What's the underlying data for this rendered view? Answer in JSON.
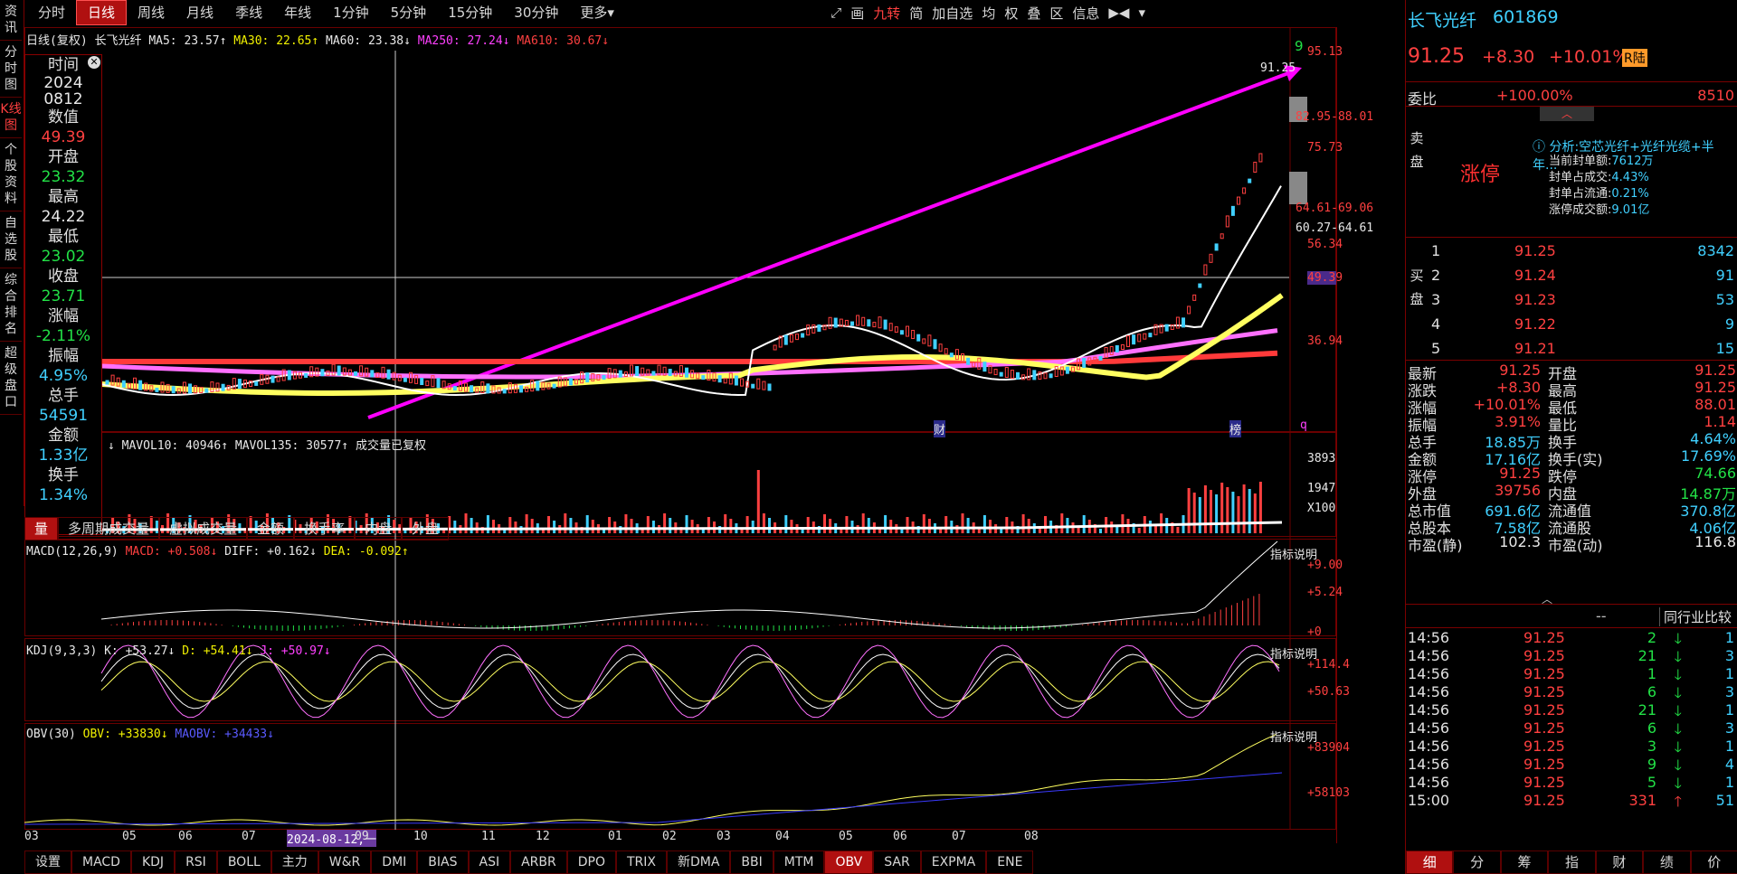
{
  "top_tabs": [
    "分时",
    "日线",
    "周线",
    "月线",
    "季线",
    "年线",
    "1分钟",
    "5分钟",
    "15分钟",
    "30分钟",
    "更多▾"
  ],
  "active_tab": "日线",
  "tool_icons": [
    "⤢",
    "画",
    "九转",
    "简",
    "加自选",
    "均",
    "权",
    "叠",
    "区",
    "信息",
    "▶◀",
    "▾"
  ],
  "left_nav": [
    "资讯",
    "分时图",
    "K线图",
    "个股资料",
    "自选股",
    "综合排名",
    "超级盘口"
  ],
  "chart_header": {
    "title": "日线(复权)",
    "name": "长飞光纤",
    "ma5": "MA5: 23.57↑",
    "ma30": "MA30: 22.65↑",
    "ma60": "MA60: 23.38↓",
    "ma250": "MA250: 27.24↓",
    "ma610": "MA610: 30.67↓"
  },
  "price_axis": [
    "95.13",
    "82.95-88.01",
    "75.73",
    "64.61-69.06",
    "60.27-64.61",
    "56.34",
    "49.39",
    "36.94"
  ],
  "price_peak_label": "91.25",
  "info_box": {
    "time_label": "时间",
    "time_value": "2024\n0812",
    "value_label": "数值",
    "value": "49.39",
    "open_label": "开盘",
    "open": "23.32",
    "high_label": "最高",
    "high": "24.22",
    "low_label": "最低",
    "low": "23.02",
    "close_label": "收盘",
    "close": "23.71",
    "chg_label": "涨幅",
    "chg": "-2.11%",
    "amp_label": "振幅",
    "amp": "4.95%",
    "vol_label": "总手",
    "vol": "54591",
    "amt_label": "金额",
    "amt": "1.33亿",
    "turn_label": "换手",
    "turn": "1.34%"
  },
  "vol_header": {
    "a": "↓ MAVOL10: 40946↑",
    "b": "MAVOL135: 30577↑",
    "c": "成交量已复权"
  },
  "vol_axis": [
    "3893",
    "1947",
    "X100"
  ],
  "sub_tabs": [
    "量",
    "多周期成交量",
    "虚拟成交量",
    "金额",
    "换手率",
    "内盘",
    "外盘"
  ],
  "macd_header": {
    "a": "MACD(12,26,9)",
    "b": "MACD: +0.508↓",
    "c": "DIFF: +0.162↓",
    "d": "DEA: -0.092↑"
  },
  "macd_axis": [
    "+9.00",
    "+5.24",
    "+0"
  ],
  "kdj_header": {
    "a": "KDJ(9,3,3)",
    "b": "K: +53.27↓",
    "c": "D: +54.41↓",
    "d": "J: +50.97↓"
  },
  "kdj_axis": [
    "+114.4",
    "+50.63"
  ],
  "obv_header": {
    "a": "OBV(30)",
    "b": "OBV: +33830↓",
    "c": "MAOBV: +34433↓"
  },
  "obv_axis": [
    "+83904",
    "+58103"
  ],
  "indicator_help": "指标说明",
  "x_axis": [
    "03",
    "05",
    "06",
    "07",
    "2024-08-12,一",
    "09",
    "10",
    "11",
    "12",
    "01",
    "02",
    "03",
    "04",
    "05",
    "06",
    "07",
    "08"
  ],
  "bottom_tabs": [
    "设置",
    "MACD",
    "KDJ",
    "RSI",
    "BOLL",
    "主力",
    "W&R",
    "DMI",
    "BIAS",
    "ASI",
    "ARBR",
    "DPO",
    "TRIX",
    "新DMA",
    "BBI",
    "MTM",
    "OBV",
    "SAR",
    "EXPMA",
    "ENE"
  ],
  "active_bottom": "OBV",
  "stock": {
    "name": "长飞光纤",
    "code": "601869",
    "price": "91.25",
    "change": "+8.30",
    "pct": "+10.01%",
    "badge": "R陆"
  },
  "weibi": {
    "label": "委比",
    "value": "+100.00%",
    "count": "8510"
  },
  "limit_up": {
    "sell_label": "卖盘",
    "status": "涨停",
    "analysis": "分析:空芯光纤+光纤光缆+半年...",
    "lines": [
      {
        "k": "当前封单额:",
        "v": "7612万"
      },
      {
        "k": "封单占成交:",
        "v": "4.43%"
      },
      {
        "k": "封单占流通:",
        "v": "0.21%"
      },
      {
        "k": "涨停成交额:",
        "v": "9.01亿"
      }
    ]
  },
  "buy_label": "买盘",
  "bids": [
    {
      "n": "1",
      "p": "91.25",
      "v": "8342"
    },
    {
      "n": "2",
      "p": "91.24",
      "v": "91"
    },
    {
      "n": "3",
      "p": "91.23",
      "v": "53"
    },
    {
      "n": "4",
      "p": "91.22",
      "v": "9"
    },
    {
      "n": "5",
      "p": "91.21",
      "v": "15"
    }
  ],
  "quote": [
    {
      "k1": "最新",
      "v1": "91.25",
      "c1": "red",
      "k2": "开盘",
      "v2": "91.25",
      "c2": "red"
    },
    {
      "k1": "涨跌",
      "v1": "+8.30",
      "c1": "red",
      "k2": "最高",
      "v2": "91.25",
      "c2": "red"
    },
    {
      "k1": "涨幅",
      "v1": "+10.01%",
      "c1": "red",
      "k2": "最低",
      "v2": "88.01",
      "c2": "red"
    },
    {
      "k1": "振幅",
      "v1": "3.91%",
      "c1": "red",
      "k2": "量比",
      "v2": "1.14",
      "c2": "red"
    },
    {
      "k1": "总手",
      "v1": "18.85万",
      "c1": "cyan",
      "k2": "换手",
      "v2": "4.64%",
      "c2": "cyan"
    },
    {
      "k1": "金额",
      "v1": "17.16亿",
      "c1": "cyan",
      "k2": "换手(实)",
      "v2": "17.69%",
      "c2": "cyan"
    },
    {
      "k1": "涨停",
      "v1": "91.25",
      "c1": "red",
      "k2": "跌停",
      "v2": "74.66",
      "c2": "green"
    },
    {
      "k1": "外盘",
      "v1": "39756",
      "c1": "red",
      "k2": "内盘",
      "v2": "14.87万",
      "c2": "green"
    },
    {
      "k1": "总市值",
      "v1": "691.6亿",
      "c1": "cyan",
      "k2": "流通值",
      "v2": "370.8亿",
      "c2": "cyan"
    },
    {
      "k1": "总股本",
      "v1": "7.58亿",
      "c1": "cyan",
      "k2": "流通股",
      "v2": "4.06亿",
      "c2": "cyan"
    },
    {
      "k1": "市盈(静)",
      "v1": "102.3",
      "c1": "white",
      "k2": "市盈(动)",
      "v2": "116.8",
      "c2": "white"
    }
  ],
  "tick_header": {
    "dash": "--",
    "peer": "同行业比较"
  },
  "ticks": [
    {
      "t": "14:56",
      "p": "91.25",
      "v": "2",
      "d": "down",
      "n": "1"
    },
    {
      "t": "14:56",
      "p": "91.25",
      "v": "21",
      "d": "down",
      "n": "3"
    },
    {
      "t": "14:56",
      "p": "91.25",
      "v": "1",
      "d": "down",
      "n": "1"
    },
    {
      "t": "14:56",
      "p": "91.25",
      "v": "6",
      "d": "down",
      "n": "3"
    },
    {
      "t": "14:56",
      "p": "91.25",
      "v": "21",
      "d": "down",
      "n": "1"
    },
    {
      "t": "14:56",
      "p": "91.25",
      "v": "6",
      "d": "down",
      "n": "3"
    },
    {
      "t": "14:56",
      "p": "91.25",
      "v": "3",
      "d": "down",
      "n": "1"
    },
    {
      "t": "14:56",
      "p": "91.25",
      "v": "9",
      "d": "down",
      "n": "4"
    },
    {
      "t": "14:56",
      "p": "91.25",
      "v": "5",
      "d": "down",
      "n": "1"
    },
    {
      "t": "15:00",
      "p": "91.25",
      "v": "331",
      "d": "up",
      "n": "51"
    }
  ],
  "right_bottom_tabs": [
    "细",
    "分",
    "筹",
    "指",
    "财",
    "绩",
    "价"
  ],
  "chart_markers": {
    "cai": "财",
    "bang": "榜",
    "q": "q",
    "nine": "9"
  }
}
